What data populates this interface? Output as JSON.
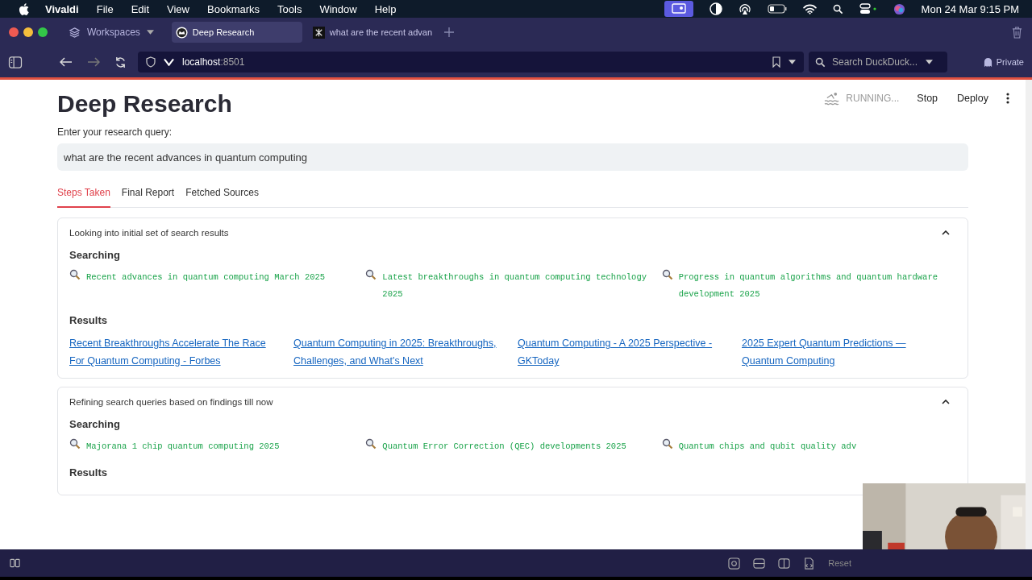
{
  "menu_bar": {
    "app": "Vivaldi",
    "items": [
      "File",
      "Edit",
      "View",
      "Bookmarks",
      "Tools",
      "Window",
      "Help"
    ],
    "clock": "Mon 24 Mar  9:15 PM"
  },
  "tab_bar": {
    "workspaces": "Workspaces",
    "tabs": [
      {
        "title": "Deep Research",
        "selected": true
      },
      {
        "title": "what are the recent advan",
        "selected": false
      }
    ]
  },
  "address_bar": {
    "host": "localhost",
    "port": ":8501",
    "search_placeholder": "Search DuckDuck...",
    "private": "Private"
  },
  "app_header": {
    "status": "RUNNING...",
    "stop": "Stop",
    "deploy": "Deploy"
  },
  "page": {
    "title": "Deep Research",
    "query_label": "Enter your research query:",
    "query": "what are the recent advances in quantum computing",
    "tabs": [
      {
        "label": "Steps Taken",
        "selected": true
      },
      {
        "label": "Final Report",
        "selected": false
      },
      {
        "label": "Fetched Sources",
        "selected": false
      }
    ],
    "steps": [
      {
        "title": "Looking into initial set of search results",
        "expanded": true,
        "searching_heading": "Searching",
        "queries": [
          "Recent advances in quantum computing March 2025",
          "Latest breakthroughs in quantum computing technology 2025",
          "Progress in quantum algorithms and quantum hardware development 2025"
        ],
        "results_heading": "Results",
        "results": [
          "Recent Breakthroughs Accelerate The Race For Quantum Computing - Forbes",
          "Quantum Computing in 2025: Breakthroughs, Challenges, and What's Next",
          "Quantum Computing - A 2025 Perspective - GKToday",
          "2025 Expert Quantum Predictions — Quantum Computing"
        ]
      },
      {
        "title": "Refining search queries based on findings till now",
        "expanded": true,
        "searching_heading": "Searching",
        "queries": [
          "Majorana 1 chip quantum computing 2025",
          "Quantum Error Correction (QEC) developments 2025",
          "Quantum chips and qubit quality adv"
        ],
        "results_heading": "Results"
      }
    ]
  },
  "bottom_bar": {
    "reset": "Reset"
  }
}
